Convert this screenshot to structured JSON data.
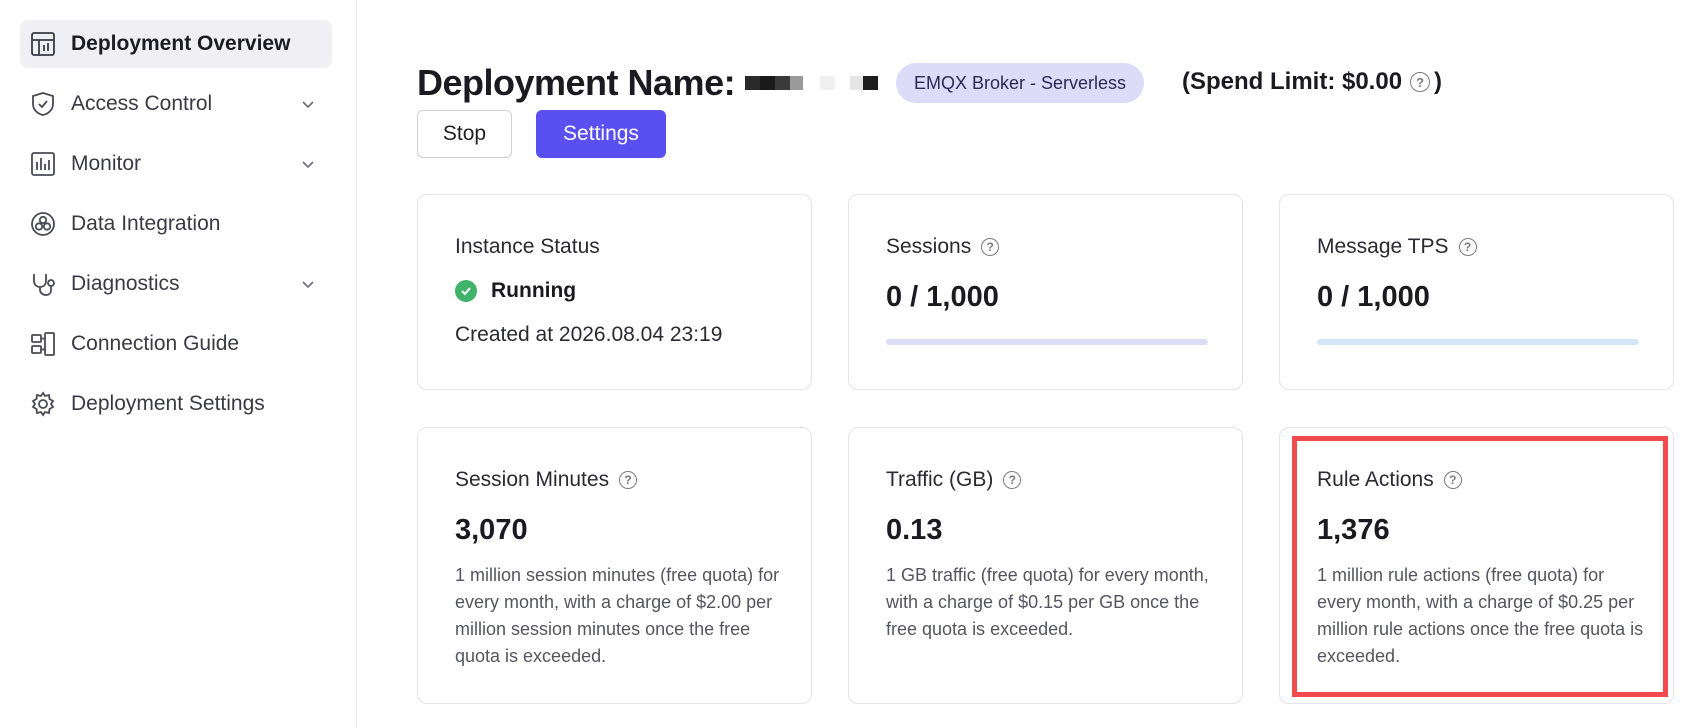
{
  "sidebar": {
    "items": [
      {
        "label": "Deployment Overview",
        "icon": "dashboard-icon",
        "active": true,
        "expandable": false
      },
      {
        "label": "Access Control",
        "icon": "shield-icon",
        "active": false,
        "expandable": true
      },
      {
        "label": "Monitor",
        "icon": "bar-chart-icon",
        "active": false,
        "expandable": true
      },
      {
        "label": "Data Integration",
        "icon": "data-integration-icon",
        "active": false,
        "expandable": false
      },
      {
        "label": "Diagnostics",
        "icon": "stethoscope-icon",
        "active": false,
        "expandable": true
      },
      {
        "label": "Connection Guide",
        "icon": "connection-icon",
        "active": false,
        "expandable": false
      },
      {
        "label": "Deployment Settings",
        "icon": "gear-icon",
        "active": false,
        "expandable": false
      }
    ]
  },
  "header": {
    "title": "Deployment Name:",
    "badge": "EMQX Broker - Serverless",
    "spend_limit_prefix": "(Spend Limit: $0.00",
    "spend_limit_suffix": ")"
  },
  "actions": {
    "stop_label": "Stop",
    "settings_label": "Settings"
  },
  "cards": {
    "instance_status": {
      "title": "Instance Status",
      "status": "Running",
      "created": "Created at 2026.08.04 23:19"
    },
    "sessions": {
      "title": "Sessions",
      "value": "0 / 1,000",
      "progress": 0,
      "bar_color": "#dcdcf6"
    },
    "message_tps": {
      "title": "Message TPS",
      "value": "0 / 1,000",
      "progress": 0,
      "bar_color": "#d3e6f7"
    },
    "session_minutes": {
      "title": "Session Minutes",
      "value": "3,070",
      "desc": "1 million session minutes (free quota) for every month, with a charge of $2.00 per million session minutes once the free quota is exceeded."
    },
    "traffic": {
      "title": "Traffic (GB)",
      "value": "0.13",
      "desc": "1 GB traffic (free quota) for every month, with a charge of $0.15 per GB once the free quota is exceeded."
    },
    "rule_actions": {
      "title": "Rule Actions",
      "value": "1,376",
      "desc": "1 million rule actions (free quota) for every month, with a charge of $0.25 per million rule actions once the free quota is exceeded."
    }
  },
  "colors": {
    "accent": "#5a4ff0",
    "running": "#3fb36a",
    "highlight": "#ef4b4f"
  }
}
